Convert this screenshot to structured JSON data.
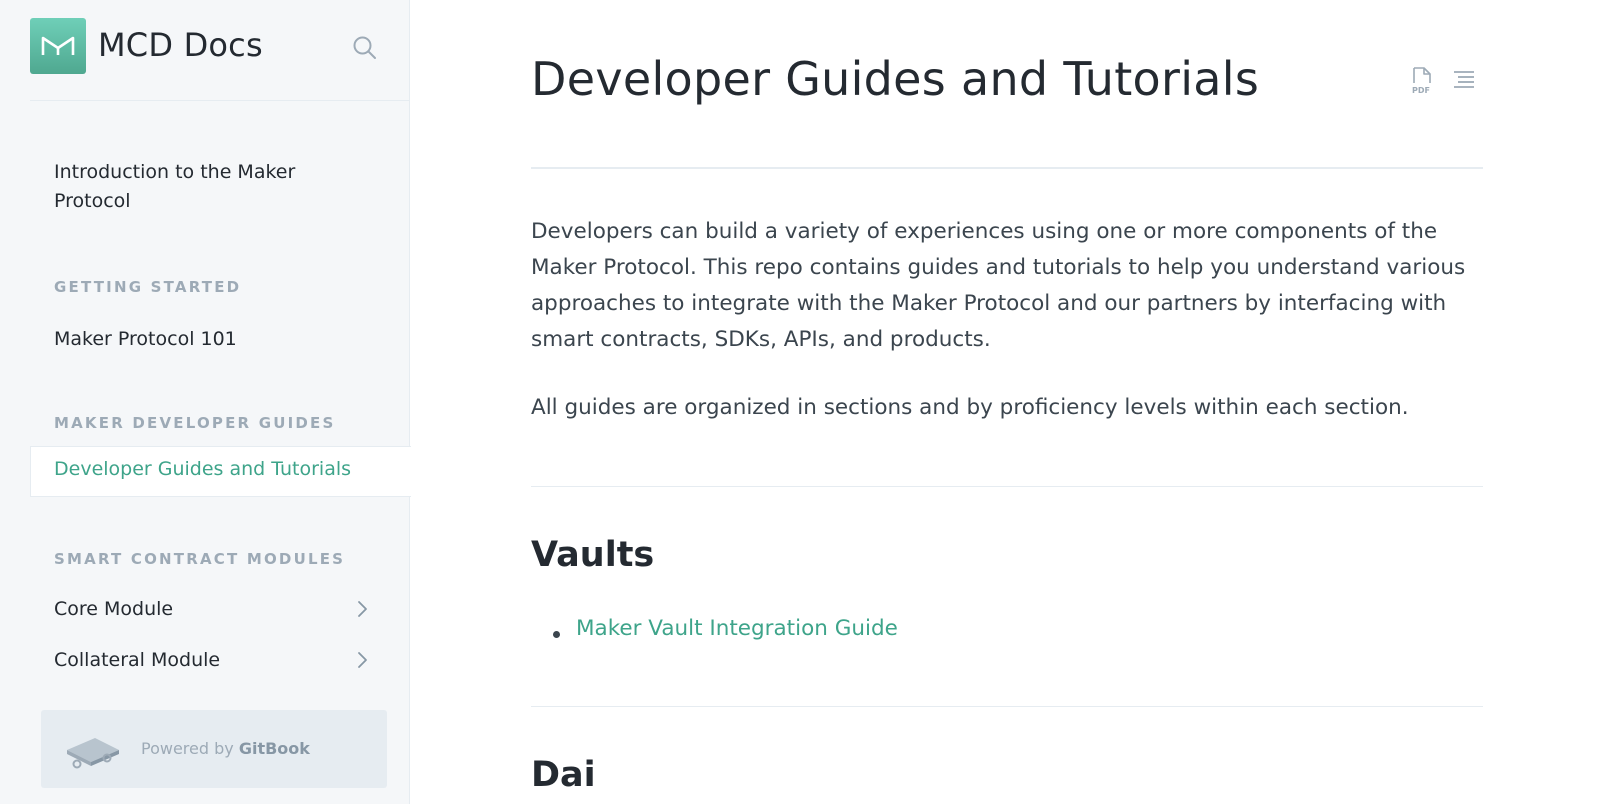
{
  "sidebar": {
    "brand_title": "MCD Docs",
    "items": {
      "intro": "Introduction to the Maker Protocol",
      "getting_started_header": "GETTING STARTED",
      "maker_101": "Maker Protocol 101",
      "dev_guides_header": "MAKER DEVELOPER GUIDES",
      "dev_guides_active": "Developer Guides and Tutorials",
      "smart_contract_header": "SMART CONTRACT MODULES",
      "core_module": "Core Module",
      "collateral_module": "Collateral Module"
    },
    "powered": {
      "prefix": "Powered by",
      "brand": "GitBook"
    }
  },
  "main": {
    "title": "Developer Guides and Tutorials",
    "intro": "Developers can build a variety of experiences using one or more components of the Maker Protocol. This repo contains guides and tutorials to help you understand various approaches to integrate with the Maker Protocol and our partners by interfacing with smart contracts, SDKs, APIs, and products.",
    "organized": "All guides are organized in sections and by proficiency levels within each section.",
    "sections": [
      {
        "heading": "Vaults",
        "links": [
          "Maker Vault Integration Guide"
        ]
      },
      {
        "heading": "Dai"
      }
    ]
  },
  "colors": {
    "accent": "#3ea48a",
    "sidebar_bg": "#f5f7f9",
    "text": "#242a31",
    "muted": "#9daab6"
  },
  "icons": [
    "maker-logo-icon",
    "search-icon",
    "pdf-icon",
    "toc-icon",
    "chevron-right-icon",
    "gitbook-icon"
  ]
}
